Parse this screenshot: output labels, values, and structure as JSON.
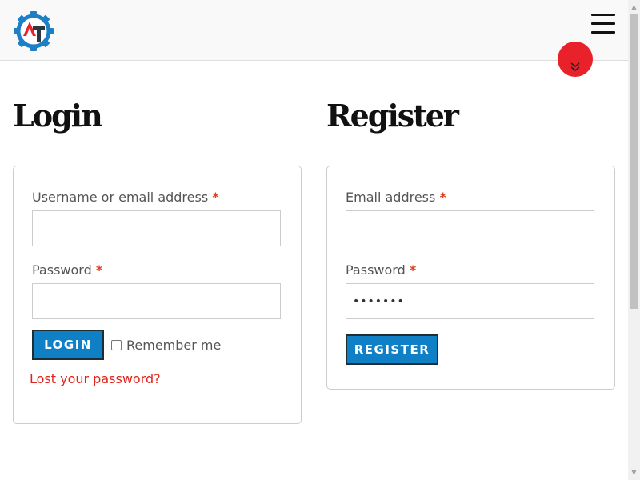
{
  "header": {
    "logo_icon": "gear-logo-icon",
    "menu_icon": "hamburger-icon",
    "scroll_down_icon": "double-chevron-down-icon"
  },
  "login": {
    "title": "Login",
    "username_label": "Username or email address",
    "required_mark": "*",
    "username_value": "",
    "password_label": "Password",
    "password_value": "",
    "login_button": "LOGIN",
    "remember_label": "Remember me",
    "remember_checked": false,
    "lost_password": "Lost your password?"
  },
  "register": {
    "title": "Register",
    "email_label": "Email address",
    "required_mark": "*",
    "email_value": "",
    "password_label": "Password",
    "password_value": "•••••••",
    "register_button": "REGISTER"
  },
  "colors": {
    "accent": "#0f7fc6",
    "required": "#e2401c",
    "link": "#e2231a",
    "badge": "#e8212a"
  }
}
